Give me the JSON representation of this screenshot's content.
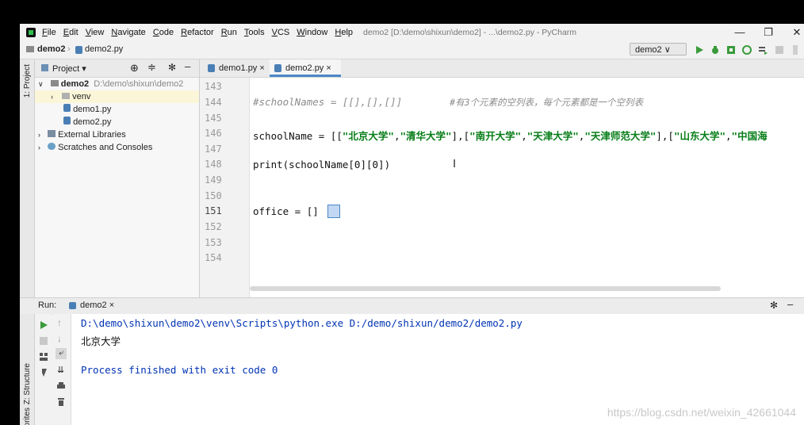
{
  "window": {
    "menu": [
      "File",
      "Edit",
      "View",
      "Navigate",
      "Code",
      "Refactor",
      "Run",
      "Tools",
      "VCS",
      "Window",
      "Help"
    ],
    "title": "demo2 [D:\\demo\\shixun\\demo2] - ...\\demo2.py - PyCharm",
    "controls": {
      "minimize": "—",
      "maximize": "❐",
      "close": "✕"
    }
  },
  "navbar": {
    "project": "demo2",
    "file": "demo2.py",
    "run_config": "demo2 ∨"
  },
  "left_strip": {
    "project_tab": "1: Project",
    "structure_tab": "Z: Structure",
    "favorites_tab": "orites"
  },
  "project_panel": {
    "header": "Project ▾",
    "tree": [
      {
        "label": "demo2",
        "path": "D:\\demo\\shixun\\demo2"
      },
      {
        "label": "venv"
      },
      {
        "label": "demo1.py"
      },
      {
        "label": "demo2.py"
      },
      {
        "label": "External Libraries"
      },
      {
        "label": "Scratches and Consoles"
      }
    ]
  },
  "editor": {
    "tabs": [
      {
        "label": "demo1.py ×"
      },
      {
        "label": "demo2.py ×"
      }
    ],
    "line_numbers": [
      "143",
      "144",
      "145",
      "146",
      "147",
      "148",
      "149",
      "150",
      "151",
      "152",
      "153",
      "154"
    ],
    "lines": {
      "l144": "#schoolNames = [[],[],[]]",
      "l144_comment": "#有3个元素的空列表，每个元素都是一个空列表",
      "l146_prefix": "schoolName = [[",
      "l146_s1": "\"北京大学\"",
      "l146_s2": "\"清华大学\"",
      "l146_s3": "\"南开大学\"",
      "l146_s4": "\"天津大学\"",
      "l146_s5": "\"天津师范大学\"",
      "l146_s6": "\"山东大学\"",
      "l146_s7": "\"中国海",
      "l148": "print(schoolName[0][0])",
      "l151": "office = []"
    }
  },
  "run": {
    "label": "Run:",
    "tab": "demo2 ×",
    "output": [
      "D:\\demo\\shixun\\demo2\\venv\\Scripts\\python.exe D:/demo/shixun/demo2/demo2.py",
      "北京大学",
      "",
      "Process finished with exit code 0"
    ]
  },
  "watermark": "https://blog.csdn.net/weixin_42661044"
}
